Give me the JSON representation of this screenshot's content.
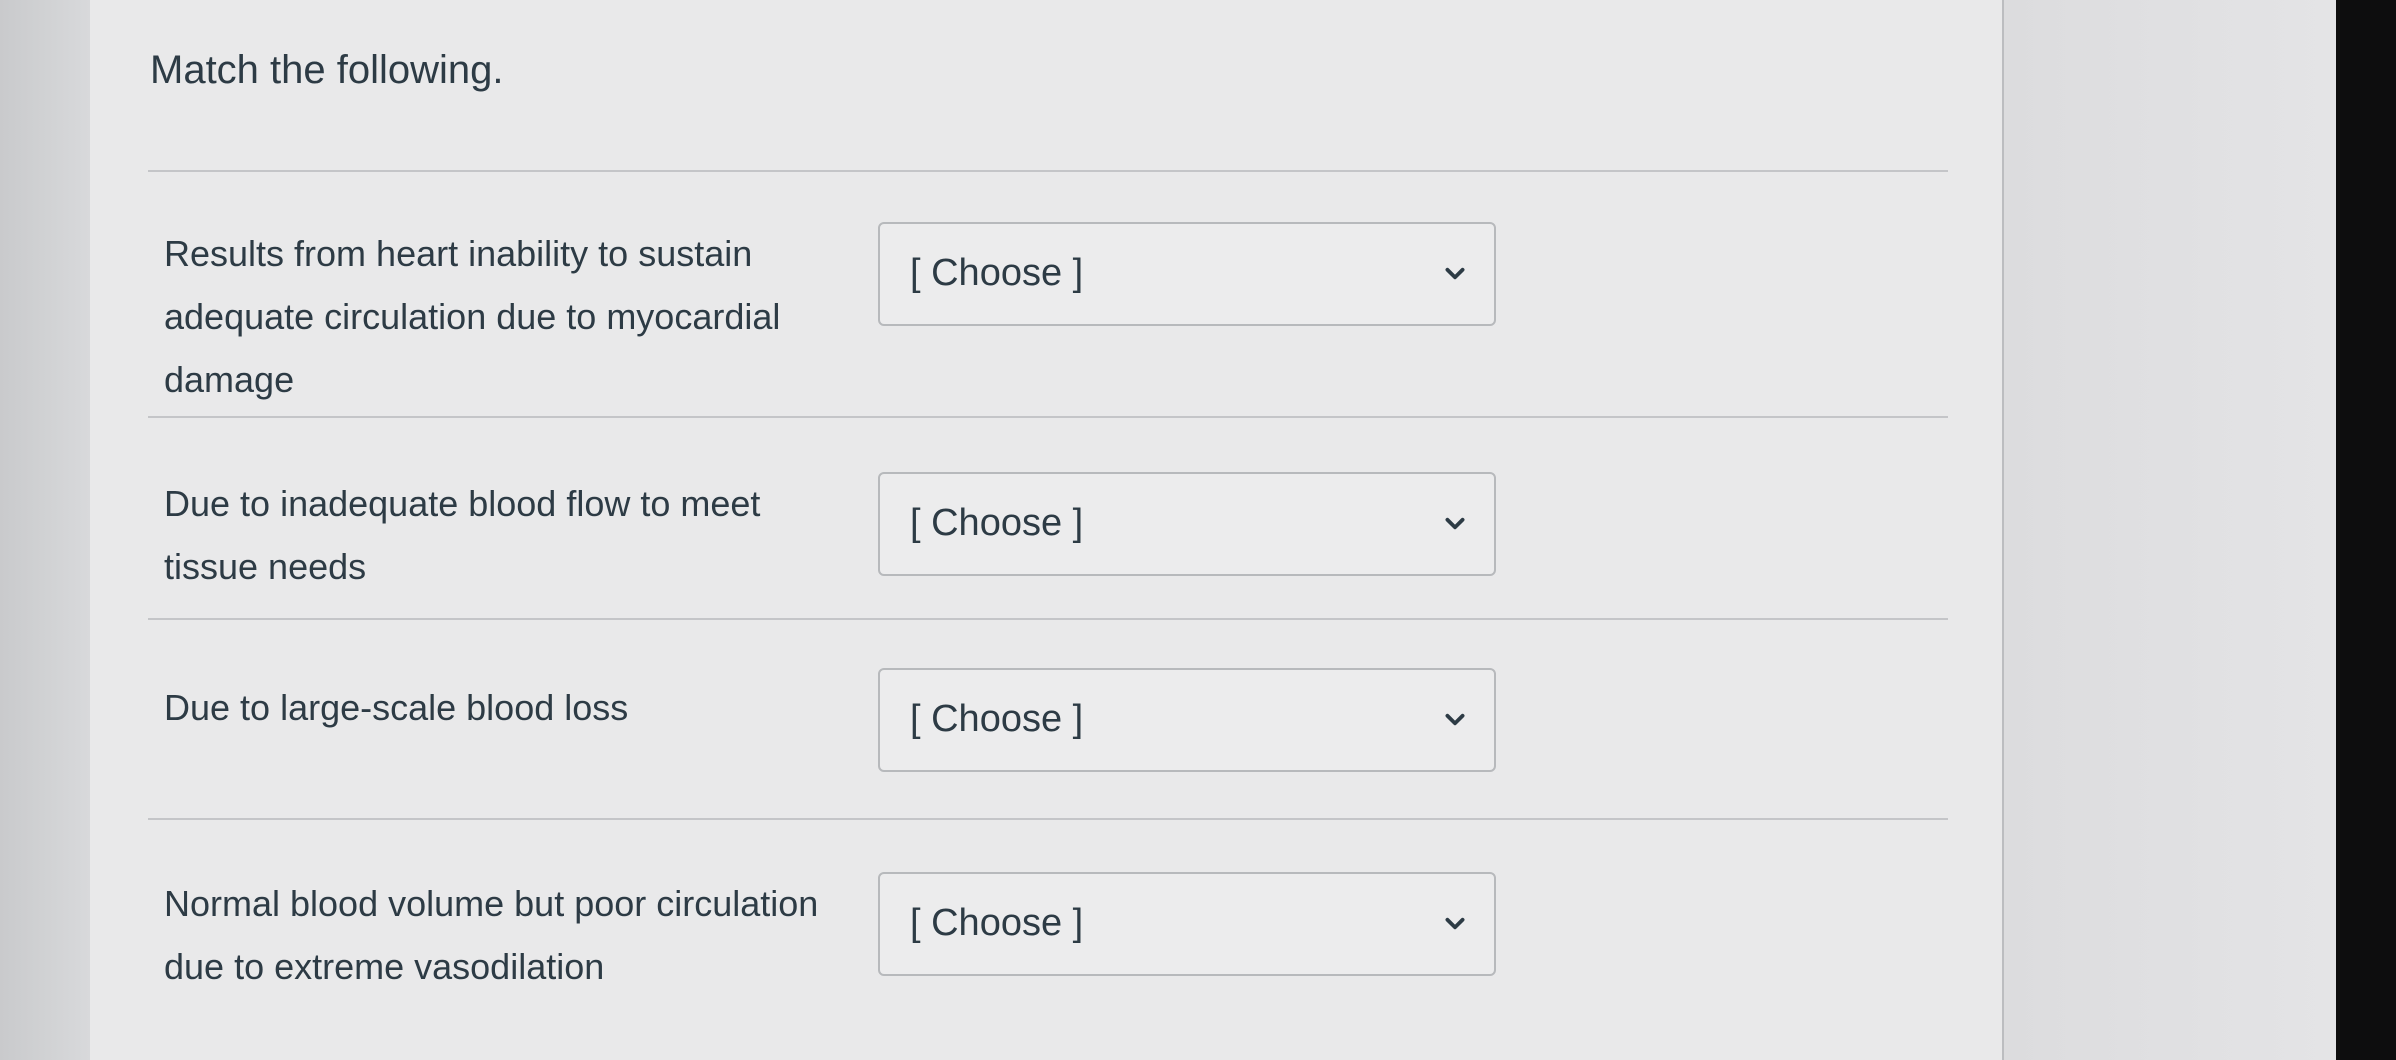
{
  "question": {
    "title": "Match the following."
  },
  "rows": [
    {
      "prompt": "Results from heart inability to sustain adequate circulation due to myocardial damage",
      "selected": "[ Choose ]"
    },
    {
      "prompt": "Due to inadequate blood flow to meet tissue needs",
      "selected": "[ Choose ]"
    },
    {
      "prompt": "Due to large-scale blood loss",
      "selected": "[ Choose ]"
    },
    {
      "prompt": "Normal blood volume but poor circulation due to extreme vasodilation",
      "selected": "[ Choose ]"
    }
  ],
  "icons": {
    "dropdown": "chevron-down-icon"
  },
  "colors": {
    "text": "#2d3b45",
    "panel": "#e9e9ea",
    "border": "#b7b9bc"
  }
}
